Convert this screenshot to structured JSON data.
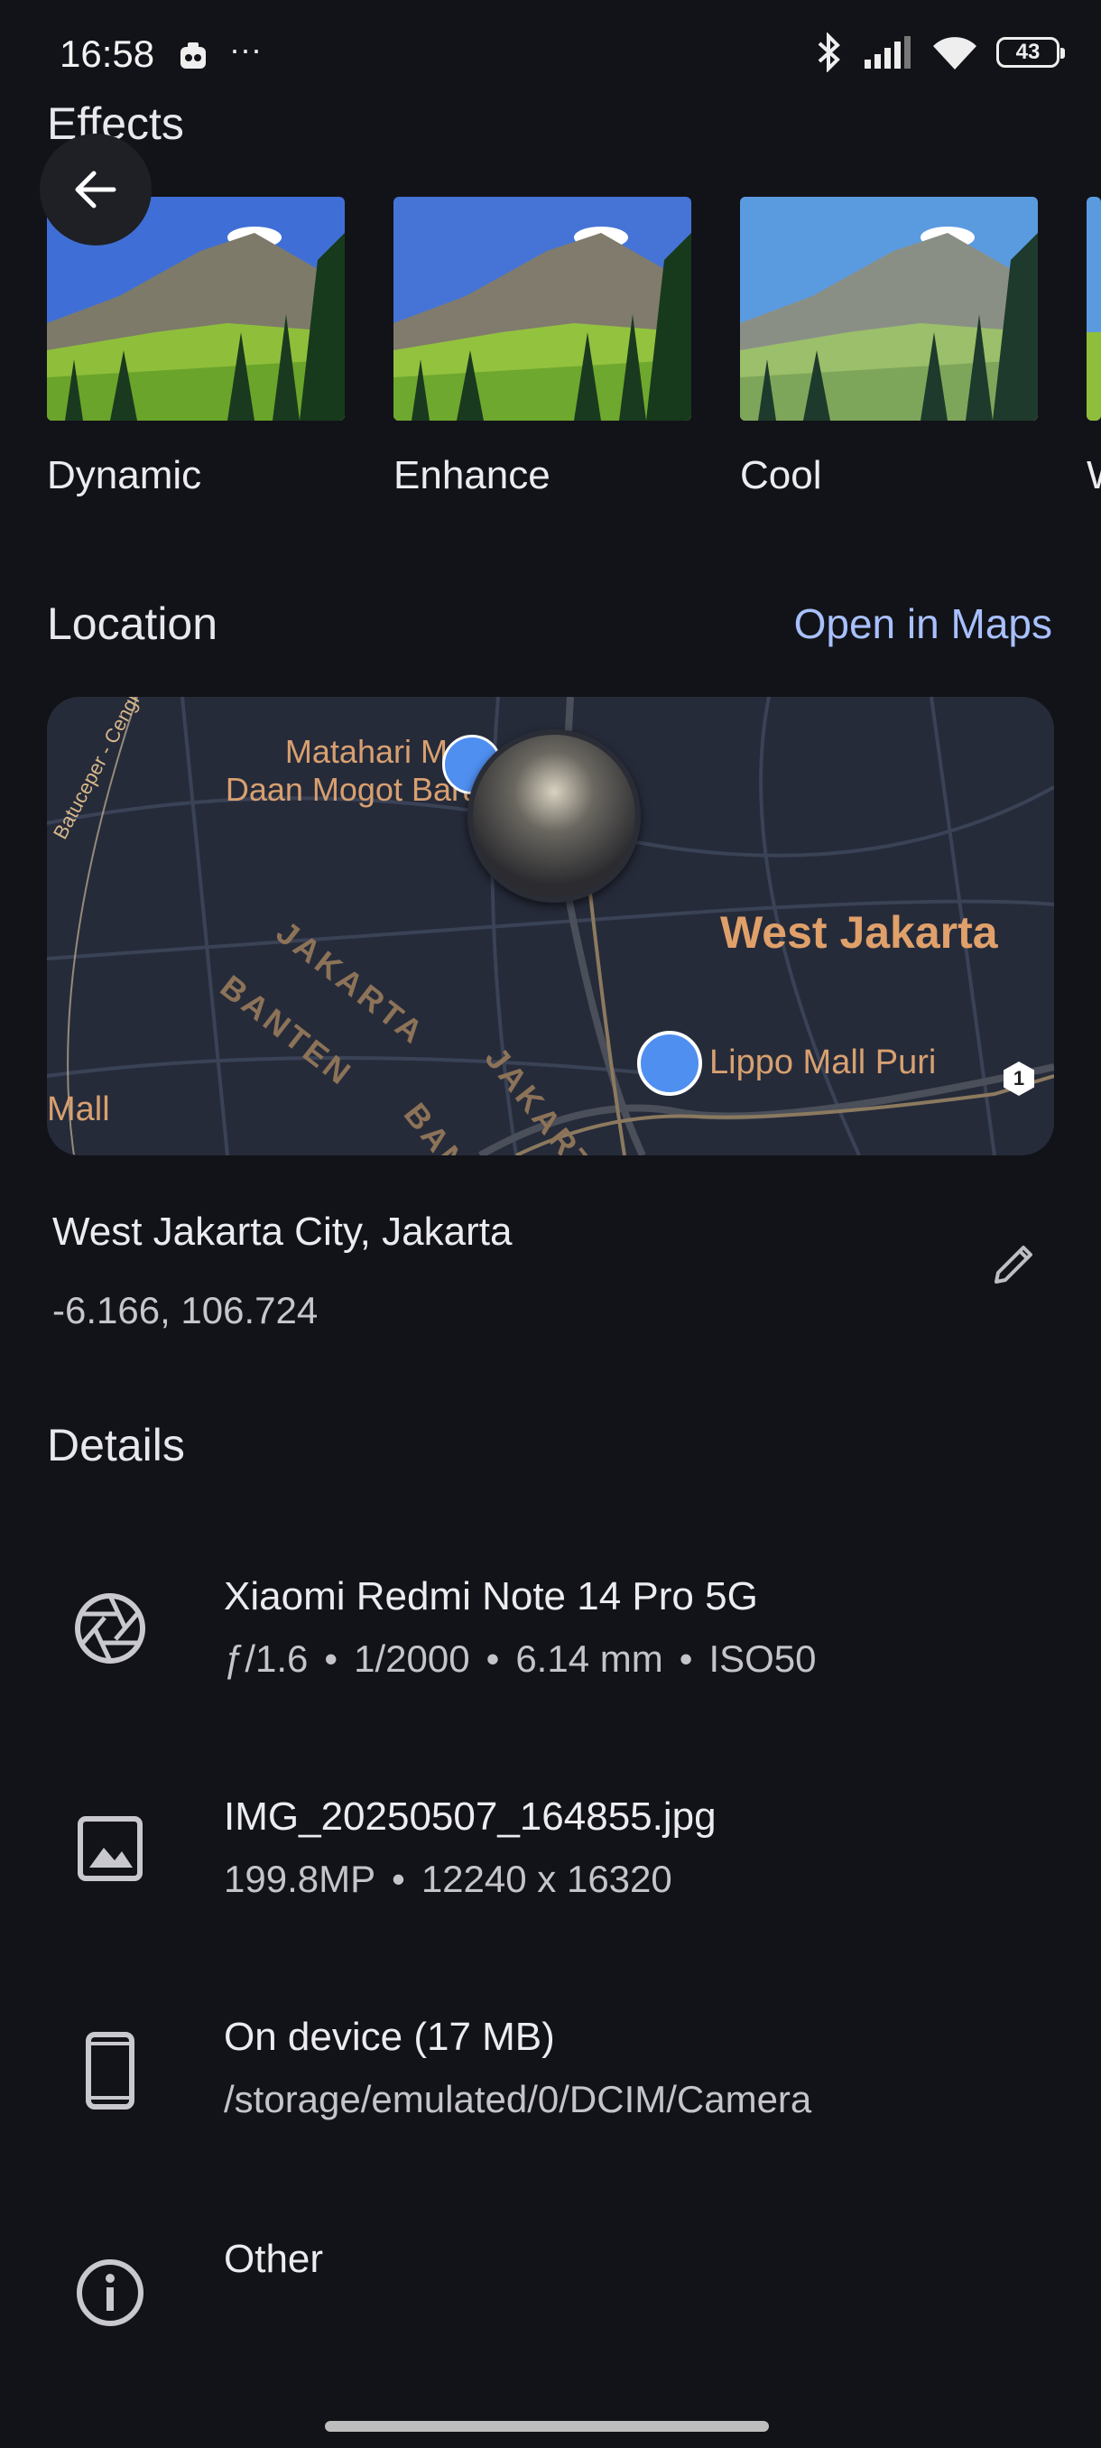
{
  "status_bar": {
    "time": "16:58",
    "more": "···",
    "battery": "43"
  },
  "effects": {
    "title": "Effects",
    "items": [
      {
        "label": "Dynamic"
      },
      {
        "label": "Enhance"
      },
      {
        "label": "Cool"
      },
      {
        "label": "W"
      }
    ]
  },
  "location": {
    "title": "Location",
    "open_maps_label": "Open in Maps",
    "map_labels": {
      "area_top": "Batuceper - Cengkare",
      "mall1_line1": "Matahari Mall",
      "mall1_line2": "Daan Mogot Baru",
      "region": "West Jakarta",
      "jakarta_diag": "JAKARTA",
      "banten_diag": "BANTEN",
      "jakarta_diag2": "JAKART",
      "banten_diag2": "BAN",
      "mall2": "Lippo Mall Puri",
      "mall_left": "Mall",
      "road_shield": "1"
    },
    "place": "West Jakarta City, Jakarta",
    "coordinates": "-6.166, 106.724"
  },
  "details": {
    "title": "Details",
    "camera": {
      "model": "Xiaomi Redmi Note 14 Pro 5G",
      "aperture": "ƒ/1.6",
      "shutter": "1/2000",
      "focal": "6.14 mm",
      "iso": "ISO50"
    },
    "file": {
      "name": "IMG_20250507_164855.jpg",
      "megapixels": "199.8MP",
      "resolution": "12240 x 16320"
    },
    "storage": {
      "title": "On device (17 MB)",
      "path": "/storage/emulated/0/DCIM/Camera"
    },
    "other": {
      "title": "Other"
    }
  }
}
